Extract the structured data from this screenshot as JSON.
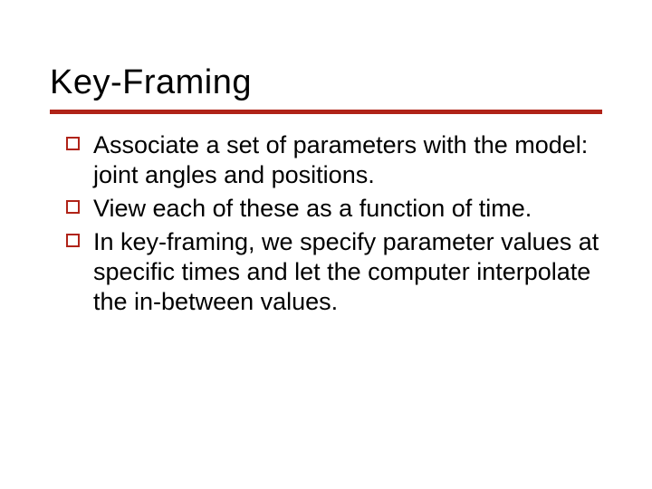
{
  "slide": {
    "title": "Key-Framing",
    "accent_color": "#b02318",
    "bullets": [
      "Associate a set of parameters with the model: joint angles and positions.",
      "View each of these as a function of time.",
      "In key-framing, we specify parameter values at specific times and let the computer interpolate the in-between values."
    ]
  }
}
